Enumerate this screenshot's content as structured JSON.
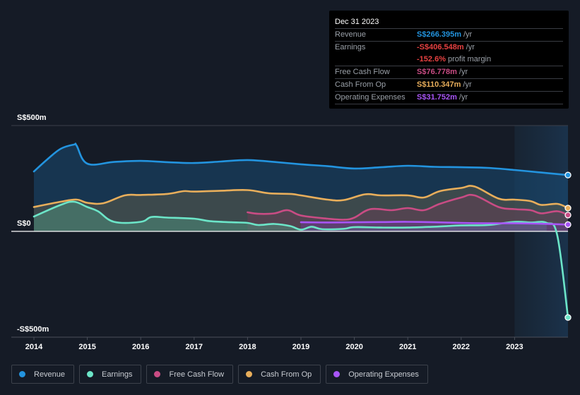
{
  "tooltip": {
    "date": "Dec 31 2023",
    "rows": [
      {
        "label": "Revenue",
        "value": "S$266.395m",
        "unit": "/yr",
        "color": "#2394df"
      },
      {
        "label": "Earnings",
        "value": "-S$406.548m",
        "unit": "/yr",
        "color": "#e64141"
      },
      {
        "label": "",
        "value": "-152.6%",
        "unit": "profit margin",
        "color": "#e64141"
      },
      {
        "label": "Free Cash Flow",
        "value": "S$76.778m",
        "unit": "/yr",
        "color": "#c94c84"
      },
      {
        "label": "Cash From Op",
        "value": "S$110.347m",
        "unit": "/yr",
        "color": "#e8ae5b"
      },
      {
        "label": "Operating Expenses",
        "value": "S$31.752m",
        "unit": "/yr",
        "color": "#a855f7"
      }
    ]
  },
  "legend": [
    {
      "label": "Revenue",
      "color": "#2394df"
    },
    {
      "label": "Earnings",
      "color": "#6ce5c8"
    },
    {
      "label": "Free Cash Flow",
      "color": "#c94c84"
    },
    {
      "label": "Cash From Op",
      "color": "#e8ae5b"
    },
    {
      "label": "Operating Expenses",
      "color": "#a855f7"
    }
  ],
  "chart_data": {
    "type": "area",
    "title": "",
    "xlabel": "",
    "ylabel": "",
    "x_ticks": [
      "2014",
      "2015",
      "2016",
      "2017",
      "2018",
      "2019",
      "2020",
      "2021",
      "2022",
      "2023"
    ],
    "y_ticks": [
      {
        "value": 500,
        "label": "S$500m"
      },
      {
        "value": 0,
        "label": "S$0"
      },
      {
        "value": -500,
        "label": "-S$500m"
      }
    ],
    "xlim": [
      2014.0,
      2024.0
    ],
    "ylim": [
      -500,
      500
    ],
    "highlight_region": [
      2023.0,
      2024.0
    ],
    "series": [
      {
        "name": "Revenue",
        "color": "#2394df",
        "x": [
          2014.0,
          2014.25,
          2014.5,
          2014.75,
          2014.8,
          2015.0,
          2015.5,
          2016.0,
          2016.5,
          2017.0,
          2017.5,
          2018.0,
          2018.5,
          2019.0,
          2019.5,
          2020.0,
          2020.5,
          2021.0,
          2021.5,
          2022.0,
          2022.5,
          2023.0,
          2023.5,
          2024.0
        ],
        "values": [
          283,
          340,
          390,
          410,
          405,
          320,
          328,
          333,
          327,
          323,
          330,
          337,
          328,
          317,
          308,
          297,
          303,
          310,
          305,
          303,
          300,
          290,
          278,
          266
        ]
      },
      {
        "name": "Cash From Op",
        "color": "#e8ae5b",
        "x": [
          2014.0,
          2014.5,
          2014.8,
          2015.0,
          2015.3,
          2015.7,
          2016.0,
          2016.5,
          2016.8,
          2017.0,
          2017.5,
          2018.0,
          2018.4,
          2018.8,
          2019.0,
          2019.5,
          2019.8,
          2020.2,
          2020.5,
          2021.0,
          2021.3,
          2021.6,
          2022.0,
          2022.25,
          2022.7,
          2023.0,
          2023.3,
          2023.5,
          2023.8,
          2024.0
        ],
        "values": [
          115,
          140,
          150,
          135,
          133,
          170,
          172,
          177,
          190,
          188,
          192,
          195,
          180,
          177,
          170,
          150,
          148,
          175,
          170,
          170,
          160,
          190,
          205,
          212,
          155,
          150,
          143,
          125,
          130,
          110
        ]
      },
      {
        "name": "Free Cash Flow",
        "color": "#c94c84",
        "x": [
          2018.0,
          2018.2,
          2018.5,
          2018.75,
          2019.0,
          2019.5,
          2019.8,
          2020.0,
          2020.3,
          2020.7,
          2021.0,
          2021.3,
          2021.6,
          2022.0,
          2022.25,
          2022.7,
          2023.0,
          2023.3,
          2023.5,
          2023.8,
          2024.0
        ],
        "values": [
          90,
          83,
          85,
          100,
          75,
          60,
          55,
          65,
          105,
          100,
          110,
          100,
          130,
          160,
          170,
          115,
          105,
          100,
          85,
          95,
          77
        ]
      },
      {
        "name": "Earnings",
        "color": "#6ce5c8",
        "x": [
          2014.0,
          2014.5,
          2014.75,
          2015.0,
          2015.2,
          2015.5,
          2016.0,
          2016.2,
          2016.5,
          2017.0,
          2017.3,
          2017.7,
          2018.0,
          2018.2,
          2018.5,
          2018.8,
          2019.0,
          2019.2,
          2019.4,
          2019.8,
          2020.0,
          2020.5,
          2021.0,
          2021.5,
          2022.0,
          2022.5,
          2023.0,
          2023.3,
          2023.6,
          2023.8,
          2024.0
        ],
        "values": [
          70,
          125,
          140,
          115,
          95,
          45,
          45,
          68,
          65,
          60,
          48,
          43,
          40,
          30,
          35,
          25,
          8,
          22,
          10,
          12,
          20,
          18,
          18,
          22,
          28,
          30,
          45,
          42,
          40,
          -20,
          -407
        ]
      },
      {
        "name": "Operating Expenses",
        "color": "#a855f7",
        "x": [
          2019.0,
          2019.5,
          2020.0,
          2020.5,
          2021.0,
          2021.5,
          2022.0,
          2022.5,
          2023.0,
          2023.5,
          2024.0
        ],
        "values": [
          43,
          42,
          43,
          44,
          45,
          43,
          40,
          38,
          38,
          36,
          32
        ]
      }
    ]
  }
}
